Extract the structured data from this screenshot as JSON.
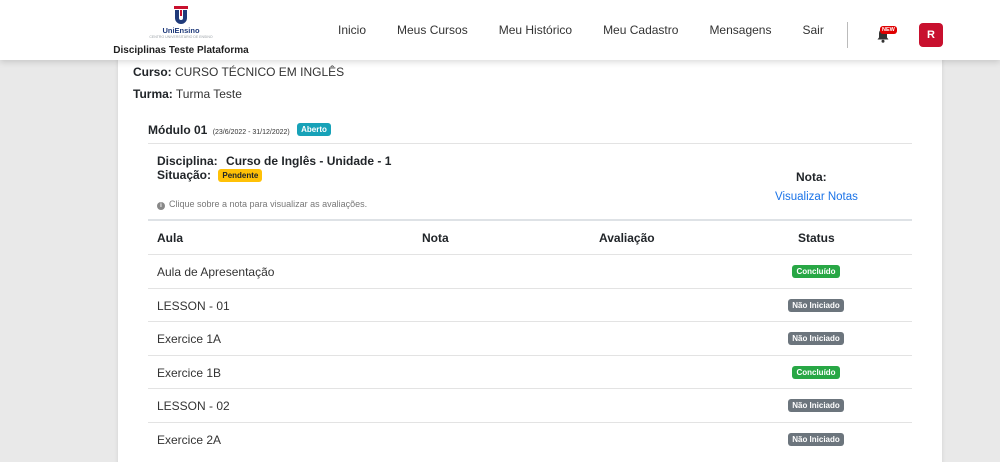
{
  "header": {
    "logo_name": "UniEnsino",
    "logo_tagline": "CENTRO UNIVERSITÁRIO DE ENSINO",
    "subtitle": "Disciplinas Teste Plataforma",
    "nav": [
      "Inicio",
      "Meus Cursos",
      "Meu Histórico",
      "Meu Cadastro",
      "Mensagens",
      "Sair"
    ],
    "new_badge": "NEW",
    "avatar_initial": "R",
    "colors": {
      "logo_blue": "#1f3a7a",
      "logo_red": "#c8102e",
      "avatar_bg": "#c8102e",
      "badge_new": "#e00000"
    }
  },
  "course": {
    "curso_label": "Curso:",
    "curso_value": "CURSO TÉCNICO EM INGLÊS",
    "turma_label": "Turma:",
    "turma_value": "Turma Teste"
  },
  "module": {
    "title": "Módulo 01",
    "dates": "(23/6/2022 - 31/12/2022)",
    "status_badge": "Aberto",
    "disciplina_label": "Disciplina:",
    "disciplina_value": "Curso de Inglês - Unidade - 1",
    "situacao_label": "Situação:",
    "situacao_badge": "Pendente",
    "nota_label": "Nota:",
    "ver_notas_link": "Visualizar Notas",
    "hint": "Clique sobre a nota para visualizar as avaliações."
  },
  "table": {
    "headers": [
      "Aula",
      "Nota",
      "Avaliação",
      "Status"
    ],
    "rows": [
      {
        "aula": "Aula de Apresentação",
        "nota": "",
        "avaliacao": "",
        "status": "Concluído",
        "status_type": "success"
      },
      {
        "aula": "LESSON - 01",
        "nota": "",
        "avaliacao": "",
        "status": "Não Iniciado",
        "status_type": "secondary"
      },
      {
        "aula": "Exercice 1A",
        "nota": "",
        "avaliacao": "",
        "status": "Não Iniciado",
        "status_type": "secondary"
      },
      {
        "aula": "Exercice 1B",
        "nota": "",
        "avaliacao": "",
        "status": "Concluído",
        "status_type": "success"
      },
      {
        "aula": "LESSON - 02",
        "nota": "",
        "avaliacao": "",
        "status": "Não Iniciado",
        "status_type": "secondary"
      },
      {
        "aula": "Exercice 2A",
        "nota": "",
        "avaliacao": "",
        "status": "Não Iniciado",
        "status_type": "secondary"
      }
    ]
  }
}
